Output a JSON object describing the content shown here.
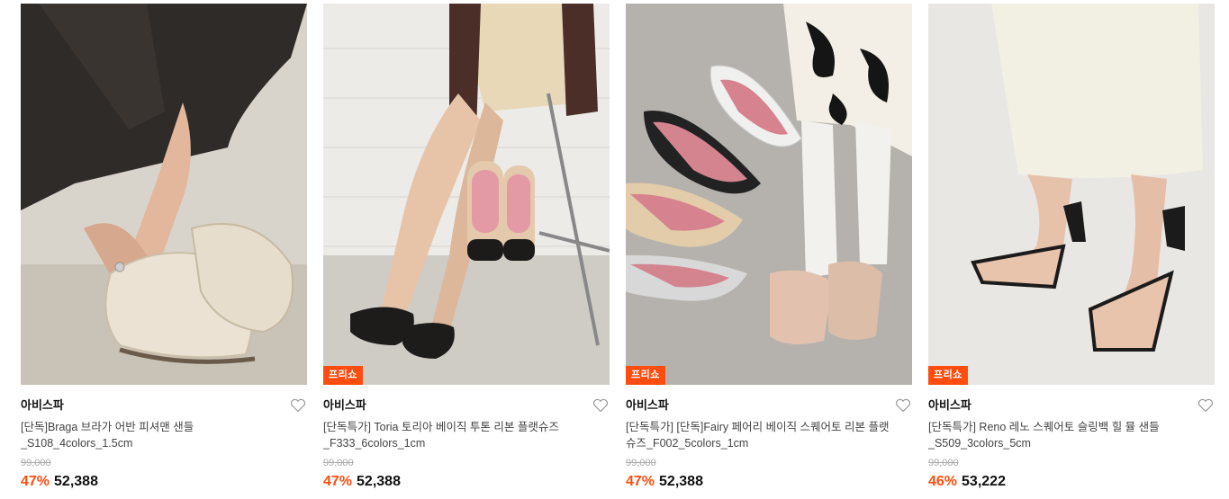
{
  "products": [
    {
      "brand": "아비스파",
      "badge": "",
      "title": "[단독]Braga 브라가 어반 피셔맨 샌들_S108_4colors_1.5cm",
      "original_price": "99,000",
      "discount": "47%",
      "price": "52,388",
      "icon": "heart-outline-icon"
    },
    {
      "brand": "아비스파",
      "badge": "프리쇼",
      "title": "[단독특가] Toria 토리아 베이직 투톤 리본 플랫슈즈_F333_6colors_1cm",
      "original_price": "99,000",
      "discount": "47%",
      "price": "52,388",
      "icon": "heart-outline-icon"
    },
    {
      "brand": "아비스파",
      "badge": "프리쇼",
      "title": "[단독특가] [단독]Fairy 페어리 베이직 스퀘어토 리본 플랫슈즈_F002_5colors_1cm",
      "original_price": "99,000",
      "discount": "47%",
      "price": "52,388",
      "icon": "heart-outline-icon"
    },
    {
      "brand": "아비스파",
      "badge": "프리쇼",
      "title": "[단독특가] Reno 레노 스퀘어토 슬링백 힐 뮬 샌들_S509_3colors_5cm",
      "original_price": "99,000",
      "discount": "46%",
      "price": "53,222",
      "icon": "heart-outline-icon"
    }
  ],
  "colors": {
    "accent": "#ff4d0f",
    "text": "#111111",
    "muted": "#aaaaaa"
  }
}
